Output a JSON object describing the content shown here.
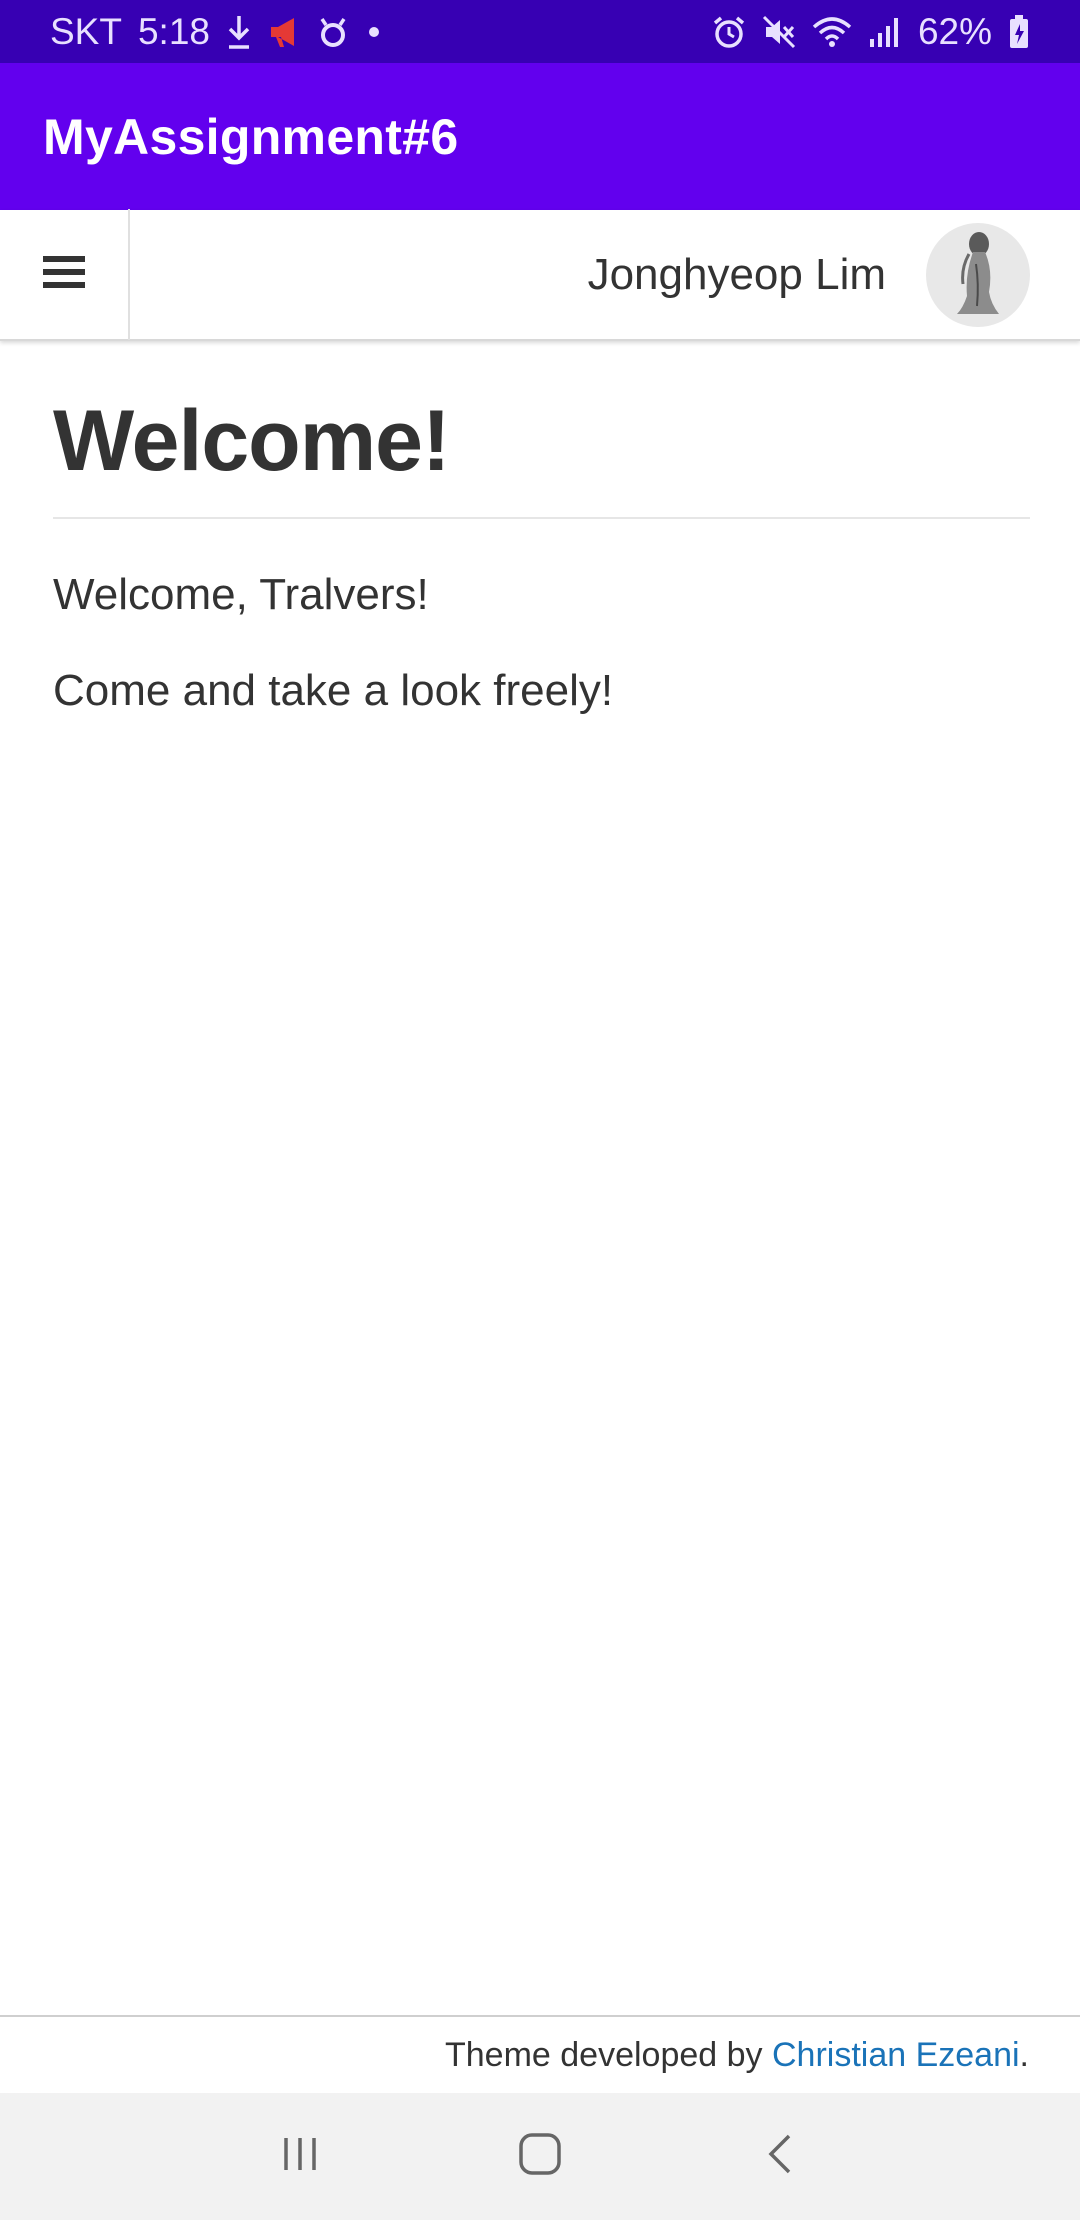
{
  "status_bar": {
    "carrier": "SKT",
    "time": "5:18",
    "battery": "62%",
    "left_icons": [
      "download-icon",
      "megaphone-icon",
      "ring-icon",
      "dot-icon"
    ],
    "right_icons": [
      "alarm-icon",
      "mute-icon",
      "wifi-icon",
      "signal-icon",
      "battery-icon"
    ],
    "colors": {
      "background": "#3700b3",
      "alert": "#e53935"
    }
  },
  "app_bar": {
    "title": "MyAssignment#6",
    "color": "#6200ee"
  },
  "nav": {
    "menu_icon": "hamburger-menu-icon",
    "user_name": "Jonghyeop Lim",
    "avatar_icon": "avatar-figure-icon"
  },
  "main": {
    "title": "Welcome!",
    "paragraphs": [
      "Welcome, Tralvers!",
      "Come and take a look freely!"
    ]
  },
  "footer": {
    "prefix": "Theme developed by ",
    "author_link": "Christian Ezeani",
    "suffix": ".",
    "link_color": "#1a73b8"
  },
  "system_nav": {
    "buttons": [
      "recents-icon",
      "home-icon",
      "back-icon"
    ]
  }
}
